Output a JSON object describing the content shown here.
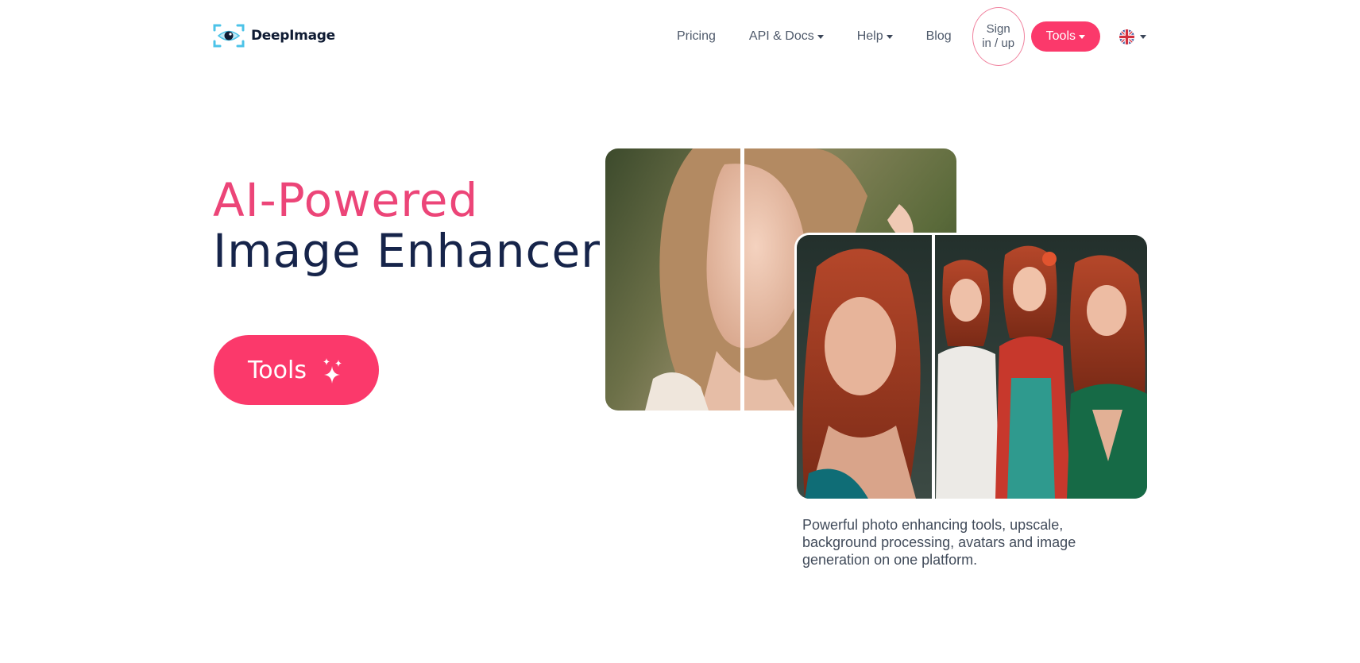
{
  "header": {
    "brand": "DeepImage",
    "nav": {
      "pricing": "Pricing",
      "api_docs": "API & Docs",
      "help": "Help",
      "blog": "Blog",
      "sign_in": "Sign in / up",
      "tools": "Tools"
    },
    "language_icon": "uk-flag-icon"
  },
  "hero": {
    "title_accent": "AI-Powered",
    "title_main": "Image Enhancer",
    "cta_label": "Tools",
    "cta_icon": "sparkles-icon",
    "description": "Powerful photo enhancing tools, upscale, background processing, avatars and image generation on one platform."
  },
  "colors": {
    "accent": "#fb396b",
    "headline_accent": "#ec4578",
    "headline_dark": "#16244a",
    "logo_cyan": "#4cc3e8"
  }
}
